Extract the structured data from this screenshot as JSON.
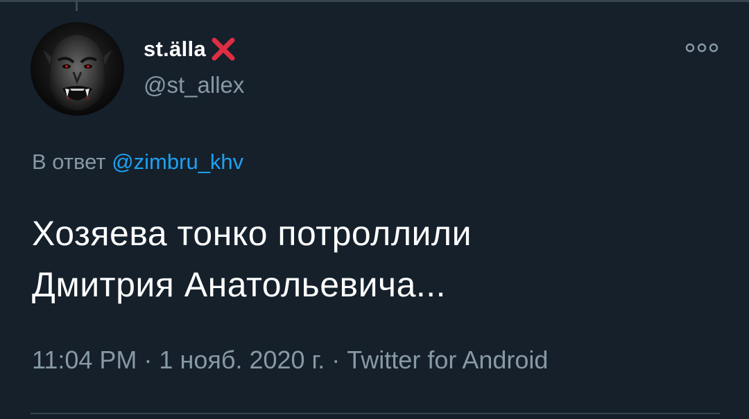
{
  "tweet": {
    "author": {
      "display_name": "st.älla",
      "name_emoji": "cross-mark-emoji",
      "handle": "@st_allex",
      "avatar": "vampire-face-avatar"
    },
    "reply_prefix": "В ответ",
    "reply_to": "@zimbru_khv",
    "text_line1": "Хозяева тонко потроллили",
    "text_line2": "Дмитрия Анатольевича...",
    "time": "11:04 PM",
    "separator": "·",
    "date": "1 нояб. 2020 г.",
    "source": "Twitter for Android"
  },
  "icons": {
    "more": "more-options-icon"
  },
  "colors": {
    "background": "#15202b",
    "primary_text": "#ffffff",
    "secondary_text": "#8899a6",
    "link": "#1da1f2",
    "emoji_red": "#dd2e44",
    "divider": "#38444d"
  }
}
